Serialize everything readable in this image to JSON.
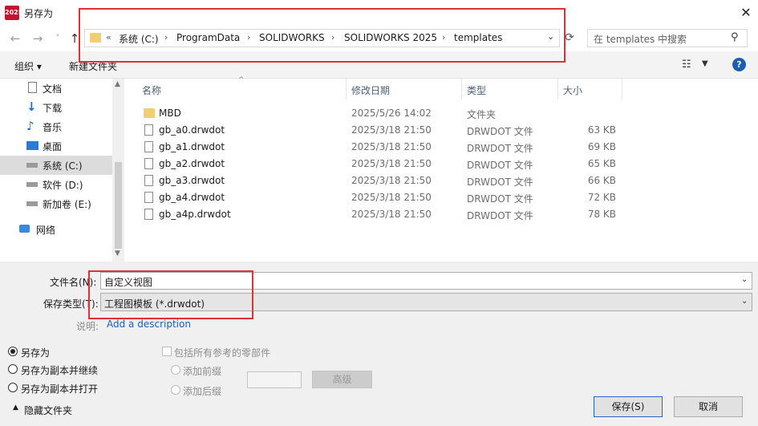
{
  "window": {
    "title": "另存为",
    "app_icon_text": "2025",
    "close": "✕"
  },
  "nav": {
    "back": "←",
    "forward": "→",
    "history": "˅",
    "up": "↑",
    "refresh": "⟳"
  },
  "address": {
    "prefix": "«",
    "crumbs": [
      "系统 (C:)",
      "ProgramData",
      "SOLIDWORKS",
      "SOLIDWORKS 2025",
      "templates"
    ],
    "separator": "›",
    "dropdown": "⌄"
  },
  "search": {
    "placeholder": "在 templates 中搜索",
    "icon": "search-icon"
  },
  "toolbar": {
    "organize": "组织 ▾",
    "new_folder": "新建文件夹"
  },
  "sidebar": {
    "items": [
      {
        "label": "文档",
        "icon": "document-icon"
      },
      {
        "label": "下载",
        "icon": "download-icon"
      },
      {
        "label": "音乐",
        "icon": "music-icon"
      },
      {
        "label": "桌面",
        "icon": "desktop-icon"
      },
      {
        "label": "系统 (C:)",
        "icon": "drive-icon",
        "selected": true
      },
      {
        "label": "软件 (D:)",
        "icon": "drive-icon"
      },
      {
        "label": "新加卷 (E:)",
        "icon": "drive-icon"
      },
      {
        "label": "网络",
        "icon": "network-icon"
      }
    ]
  },
  "columns": {
    "name": "名称",
    "modified": "修改日期",
    "type": "类型",
    "size": "大小"
  },
  "files": [
    {
      "name": "MBD",
      "modified": "2025/5/26 14:02",
      "type": "文件夹",
      "size": "",
      "kind": "folder"
    },
    {
      "name": "gb_a0.drwdot",
      "modified": "2025/3/18 21:50",
      "type": "DRWDOT 文件",
      "size": "63 KB",
      "kind": "file"
    },
    {
      "name": "gb_a1.drwdot",
      "modified": "2025/3/18 21:50",
      "type": "DRWDOT 文件",
      "size": "69 KB",
      "kind": "file"
    },
    {
      "name": "gb_a2.drwdot",
      "modified": "2025/3/18 21:50",
      "type": "DRWDOT 文件",
      "size": "65 KB",
      "kind": "file"
    },
    {
      "name": "gb_a3.drwdot",
      "modified": "2025/3/18 21:50",
      "type": "DRWDOT 文件",
      "size": "66 KB",
      "kind": "file"
    },
    {
      "name": "gb_a4.drwdot",
      "modified": "2025/3/18 21:50",
      "type": "DRWDOT 文件",
      "size": "72 KB",
      "kind": "file"
    },
    {
      "name": "gb_a4p.drwdot",
      "modified": "2025/3/18 21:50",
      "type": "DRWDOT 文件",
      "size": "78 KB",
      "kind": "file"
    }
  ],
  "form": {
    "filename_label": "文件名(N):",
    "filename_value": "自定义视图",
    "filetype_label": "保存类型(T):",
    "filetype_value": "工程图模板 (*.drwdot)",
    "description_label": "说明:",
    "description_link": "Add a description"
  },
  "options": {
    "save_as": "另存为",
    "save_copy_continue": "另存为副本并继续",
    "save_copy_open": "另存为副本并打开",
    "include_refs": "包括所有参考的零部件",
    "add_prefix": "添加前缀",
    "add_suffix": "添加后缀",
    "advanced": "高级",
    "hide_folders": "隐藏文件夹"
  },
  "buttons": {
    "save": "保存(S)",
    "cancel": "取消"
  },
  "colors": {
    "highlight_box": "#e0303a",
    "accent": "#1a5fb4",
    "folder": "#f2cf6e"
  }
}
